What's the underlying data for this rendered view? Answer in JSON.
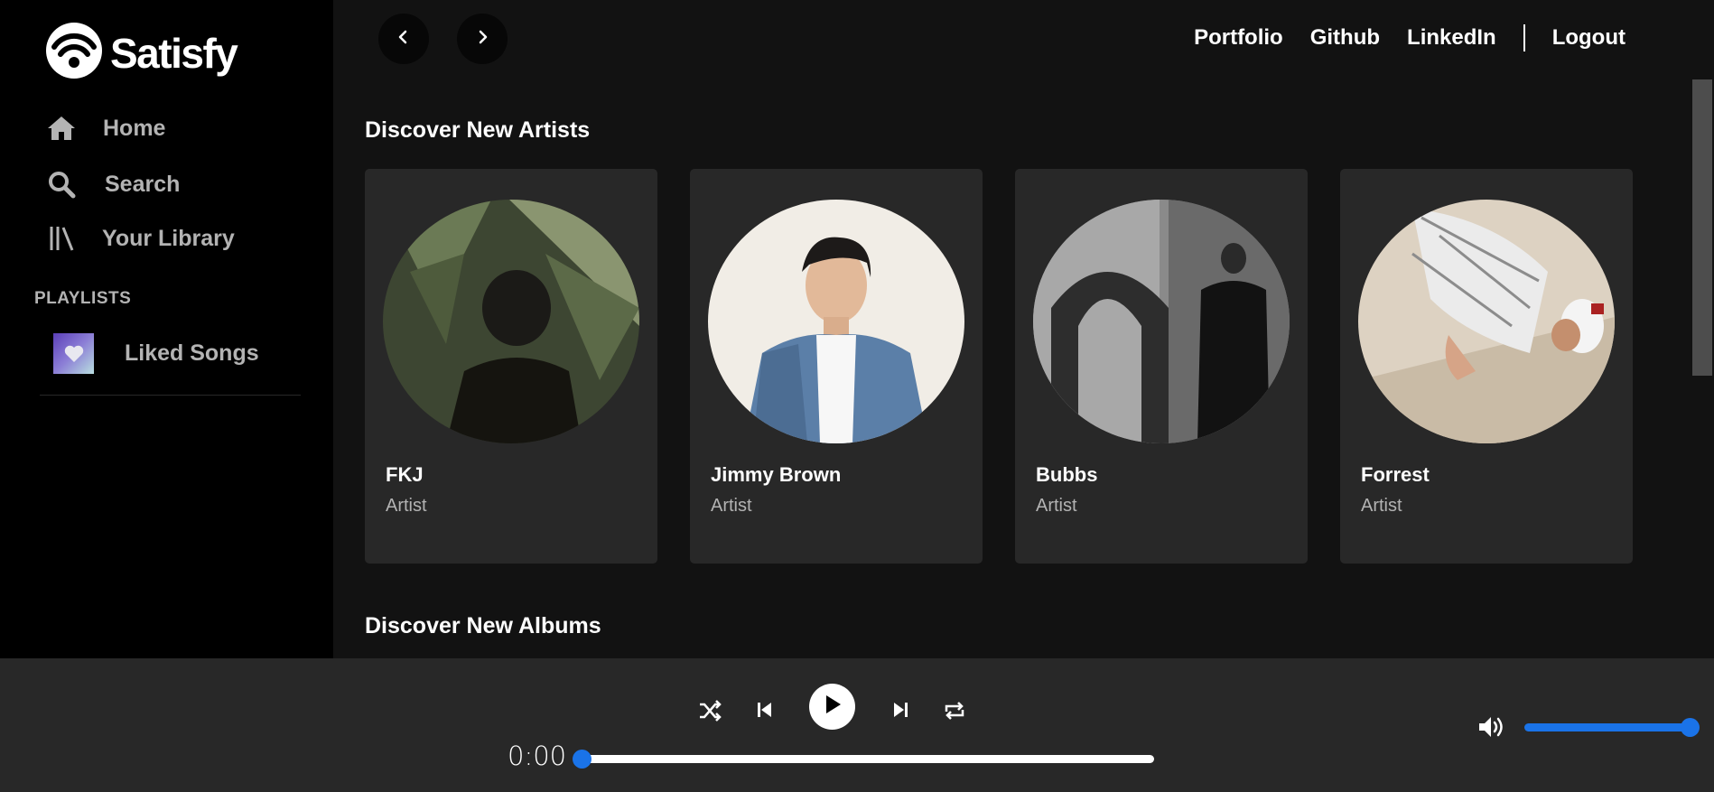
{
  "brand": {
    "name": "Satisfy",
    "logo_icon": "wifi-broadcast-icon"
  },
  "sidebar": {
    "nav": [
      {
        "label": "Home",
        "icon": "home-icon"
      },
      {
        "label": "Search",
        "icon": "search-icon"
      },
      {
        "label": "Your Library",
        "icon": "library-icon"
      }
    ],
    "playlists_heading": "PLAYLISTS",
    "playlists": [
      {
        "label": "Liked Songs",
        "icon": "heart-icon"
      }
    ]
  },
  "header": {
    "links": [
      "Portfolio",
      "Github",
      "LinkedIn"
    ],
    "logout": "Logout"
  },
  "sections": {
    "artists_title": "Discover New Artists",
    "albums_title": "Discover New Albums"
  },
  "artists": [
    {
      "name": "FKJ",
      "type": "Artist"
    },
    {
      "name": "Jimmy Brown",
      "type": "Artist"
    },
    {
      "name": "Bubbs",
      "type": "Artist"
    },
    {
      "name": "Forrest",
      "type": "Artist"
    }
  ],
  "player": {
    "current_time": "0:00",
    "progress": 0,
    "volume": 1.0,
    "controls": [
      "shuffle-icon",
      "previous-icon",
      "play-icon",
      "next-icon",
      "repeat-icon"
    ]
  },
  "colors": {
    "sidebar_bg": "#000000",
    "main_bg": "#121212",
    "card_bg": "#282828",
    "player_bg": "#282828",
    "accent": "#1a73e8",
    "muted_text": "#b3b3b3"
  }
}
